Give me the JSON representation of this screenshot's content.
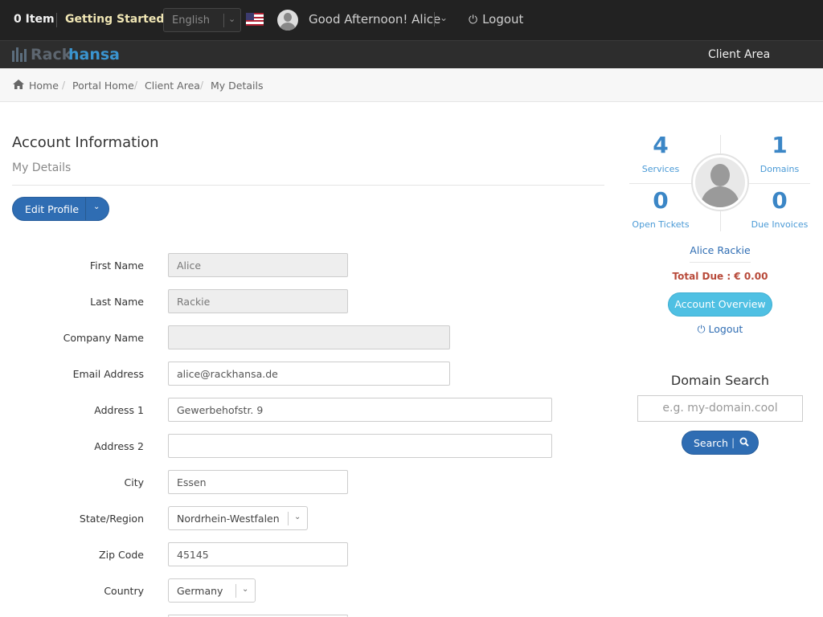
{
  "topbar": {
    "cart_items": "0 Item",
    "getting_started": "Getting Started",
    "language": "English",
    "greeting": "Good Afternoon! Alice",
    "logout": "Logout"
  },
  "brand": {
    "logo_part1": "Rack",
    "logo_part2": "hansa",
    "client_area": "Client Area"
  },
  "breadcrumb": [
    "Home",
    "Portal Home",
    "Client Area",
    "My Details"
  ],
  "header": {
    "title": "Account Information",
    "subtitle": "My Details",
    "edit_profile": "Edit Profile"
  },
  "form": {
    "fields": [
      {
        "label": "First Name",
        "value": "Alice"
      },
      {
        "label": "Last Name",
        "value": "Rackie"
      },
      {
        "label": "Company Name",
        "value": ""
      },
      {
        "label": "Email Address",
        "value": "alice@rackhansa.de"
      },
      {
        "label": "Address 1",
        "value": "Gewerbehofstr. 9"
      },
      {
        "label": "Address 2",
        "value": ""
      },
      {
        "label": "City",
        "value": "Essen"
      },
      {
        "label": "State/Region",
        "value": "Nordrhein-Westfalen"
      },
      {
        "label": "Zip Code",
        "value": "45145"
      },
      {
        "label": "Country",
        "value": "Germany"
      }
    ]
  },
  "sidebar": {
    "stats": [
      {
        "value": "4",
        "label": "Services"
      },
      {
        "value": "1",
        "label": "Domains"
      },
      {
        "value": "0",
        "label": "Open Tickets"
      },
      {
        "value": "0",
        "label": "Due Invoices"
      }
    ],
    "user_name": "Alice Rackie",
    "total_due": "Total Due : € 0.00",
    "account_overview": "Account Overview",
    "logout": "Logout"
  },
  "domain_search": {
    "title": "Domain Search",
    "placeholder": "e.g. my-domain.cool",
    "button": "Search"
  },
  "colors": {
    "topbar_bg": "#222222",
    "primary": "#2f6db3",
    "info": "#4fc0e3",
    "danger_text": "#b84a3a"
  }
}
